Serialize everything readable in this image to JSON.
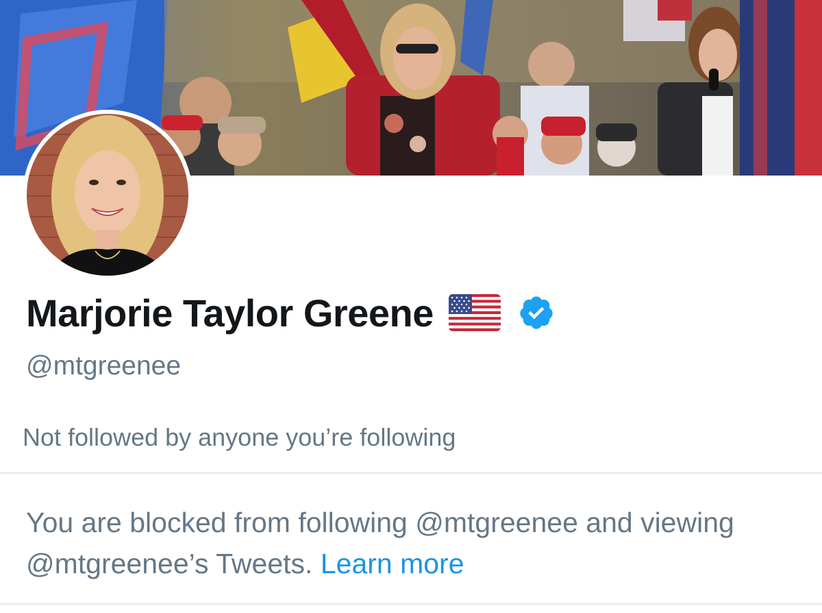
{
  "profile": {
    "display_name": "Marjorie Taylor Greene",
    "handle": "@mtgreenee",
    "badges": {
      "flag_icon": "us-flag-emoji",
      "verified_icon": "verified-badge-icon",
      "verified_color": "#1da1f2"
    }
  },
  "social_context": {
    "followers_you_know": "Not followed by anyone you’re following"
  },
  "blocked_notice": {
    "message": "You are blocked from following @mtgreenee and viewing @mtgreenee’s Tweets.",
    "link_label": "Learn more",
    "link_color": "#1b95e0"
  },
  "colors": {
    "name_text": "#14171a",
    "secondary_text": "#657786",
    "divider": "#e1e8ed"
  }
}
